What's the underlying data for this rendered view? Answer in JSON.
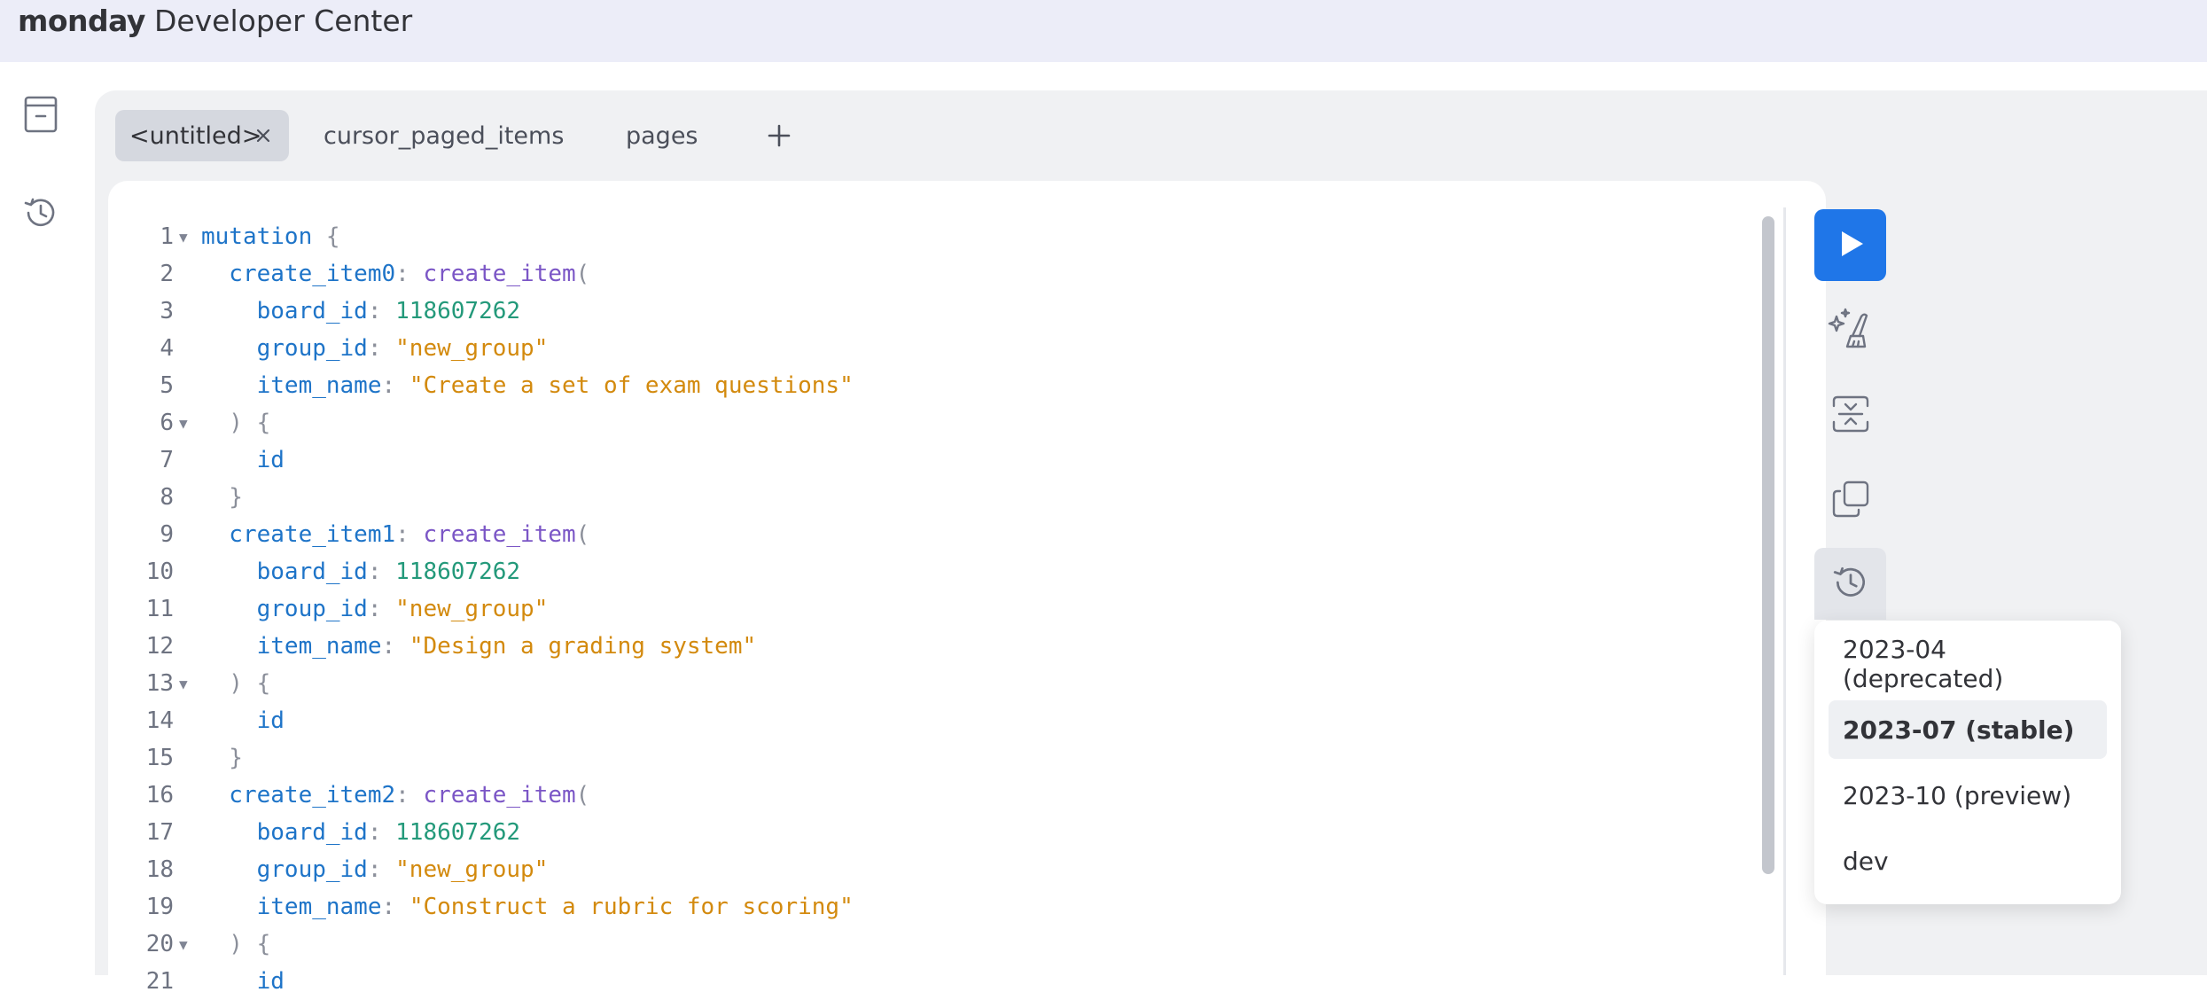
{
  "header": {
    "brand_bold": "monday",
    "brand_light": "Developer Center",
    "background": "#ecedf8"
  },
  "left_rail": [
    {
      "icon": "archive-icon"
    },
    {
      "icon": "history-icon"
    }
  ],
  "tabs": [
    {
      "label": "<untitled>",
      "active": true,
      "closable": true
    },
    {
      "label": "cursor_paged_items",
      "active": false
    },
    {
      "label": "pages",
      "active": false
    }
  ],
  "add_tab_icon": "plus-icon",
  "editor": {
    "lines": [
      {
        "n": "1",
        "fold": true,
        "tokens": [
          {
            "t": "mutation",
            "c": "kw"
          },
          {
            "t": " {",
            "c": "pn"
          }
        ]
      },
      {
        "n": "2",
        "fold": false,
        "tokens": [
          {
            "t": "  create_item0",
            "c": "kw"
          },
          {
            "t": ": ",
            "c": "pn"
          },
          {
            "t": "create_item",
            "c": "fn"
          },
          {
            "t": "(",
            "c": "pn"
          }
        ]
      },
      {
        "n": "3",
        "fold": false,
        "tokens": [
          {
            "t": "    board_id",
            "c": "kw"
          },
          {
            "t": ": ",
            "c": "pn"
          },
          {
            "t": "118607262",
            "c": "num"
          }
        ]
      },
      {
        "n": "4",
        "fold": false,
        "tokens": [
          {
            "t": "    group_id",
            "c": "kw"
          },
          {
            "t": ": ",
            "c": "pn"
          },
          {
            "t": "\"new_group\"",
            "c": "str"
          }
        ]
      },
      {
        "n": "5",
        "fold": false,
        "tokens": [
          {
            "t": "    item_name",
            "c": "kw"
          },
          {
            "t": ": ",
            "c": "pn"
          },
          {
            "t": "\"Create a set of exam questions\"",
            "c": "str"
          }
        ]
      },
      {
        "n": "6",
        "fold": true,
        "tokens": [
          {
            "t": "  ) {",
            "c": "pn"
          }
        ]
      },
      {
        "n": "7",
        "fold": false,
        "tokens": [
          {
            "t": "    id",
            "c": "kw"
          }
        ]
      },
      {
        "n": "8",
        "fold": false,
        "tokens": [
          {
            "t": "  }",
            "c": "pn"
          }
        ]
      },
      {
        "n": "9",
        "fold": false,
        "tokens": [
          {
            "t": "  create_item1",
            "c": "kw"
          },
          {
            "t": ": ",
            "c": "pn"
          },
          {
            "t": "create_item",
            "c": "fn"
          },
          {
            "t": "(",
            "c": "pn"
          }
        ]
      },
      {
        "n": "10",
        "fold": false,
        "tokens": [
          {
            "t": "    board_id",
            "c": "kw"
          },
          {
            "t": ": ",
            "c": "pn"
          },
          {
            "t": "118607262",
            "c": "num"
          }
        ]
      },
      {
        "n": "11",
        "fold": false,
        "tokens": [
          {
            "t": "    group_id",
            "c": "kw"
          },
          {
            "t": ": ",
            "c": "pn"
          },
          {
            "t": "\"new_group\"",
            "c": "str"
          }
        ]
      },
      {
        "n": "12",
        "fold": false,
        "tokens": [
          {
            "t": "    item_name",
            "c": "kw"
          },
          {
            "t": ": ",
            "c": "pn"
          },
          {
            "t": "\"Design a grading system\"",
            "c": "str"
          }
        ]
      },
      {
        "n": "13",
        "fold": true,
        "tokens": [
          {
            "t": "  ) {",
            "c": "pn"
          }
        ]
      },
      {
        "n": "14",
        "fold": false,
        "tokens": [
          {
            "t": "    id",
            "c": "kw"
          }
        ]
      },
      {
        "n": "15",
        "fold": false,
        "tokens": [
          {
            "t": "  }",
            "c": "pn"
          }
        ]
      },
      {
        "n": "16",
        "fold": false,
        "tokens": [
          {
            "t": "  create_item2",
            "c": "kw"
          },
          {
            "t": ": ",
            "c": "pn"
          },
          {
            "t": "create_item",
            "c": "fn"
          },
          {
            "t": "(",
            "c": "pn"
          }
        ]
      },
      {
        "n": "17",
        "fold": false,
        "tokens": [
          {
            "t": "    board_id",
            "c": "kw"
          },
          {
            "t": ": ",
            "c": "pn"
          },
          {
            "t": "118607262",
            "c": "num"
          }
        ]
      },
      {
        "n": "18",
        "fold": false,
        "tokens": [
          {
            "t": "    group_id",
            "c": "kw"
          },
          {
            "t": ": ",
            "c": "pn"
          },
          {
            "t": "\"new_group\"",
            "c": "str"
          }
        ]
      },
      {
        "n": "19",
        "fold": false,
        "tokens": [
          {
            "t": "    item_name",
            "c": "kw"
          },
          {
            "t": ": ",
            "c": "pn"
          },
          {
            "t": "\"Construct a rubric for scoring\"",
            "c": "str"
          }
        ]
      },
      {
        "n": "20",
        "fold": true,
        "tokens": [
          {
            "t": "  ) {",
            "c": "pn"
          }
        ]
      },
      {
        "n": "21",
        "fold": false,
        "tokens": [
          {
            "t": "    id",
            "c": "kw"
          }
        ]
      }
    ]
  },
  "toolbar": {
    "run_icon": "play-icon",
    "run_color": "#1f76e8",
    "tools": [
      {
        "icon": "prettify-icon"
      },
      {
        "icon": "merge-fragments-icon"
      },
      {
        "icon": "copy-icon"
      },
      {
        "icon": "history-icon"
      }
    ]
  },
  "version_menu": {
    "options": [
      {
        "label": "2023-04 (deprecated)",
        "selected": false
      },
      {
        "label": "2023-07 (stable)",
        "selected": true
      },
      {
        "label": "2023-10 (preview)",
        "selected": false
      },
      {
        "label": "dev",
        "selected": false
      }
    ]
  }
}
